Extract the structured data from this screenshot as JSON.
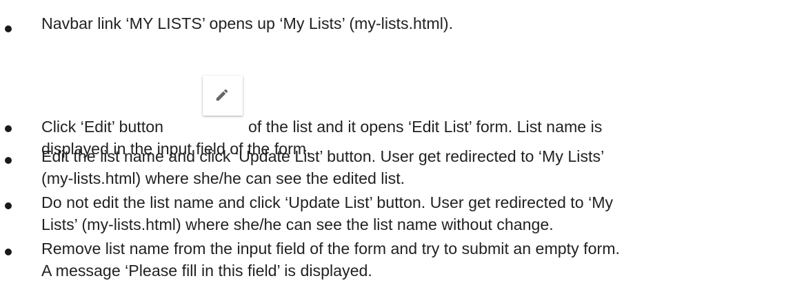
{
  "items": [
    {
      "lines": [
        "Navbar link ‘MY LISTS’ opens up ‘My Lists’ (my-lists.html)."
      ]
    },
    {
      "before_icon": "Click ‘Edit’ button",
      "after_icon": "of the list and it opens ‘Edit List’ form. List name is",
      "line2": "displayed in the input field of the form.",
      "icon": "pencil-edit-icon"
    },
    {
      "lines": [
        "Edit the list name and click ‘Update List’ button. User get redirected to ‘My Lists’",
        "(my-lists.html) where she/he can see the edited list."
      ]
    },
    {
      "lines": [
        "Do not edit the list name and click ‘Update List’ button. User get redirected to ‘My",
        "Lists’ (my-lists.html) where she/he can see the list name without change."
      ]
    },
    {
      "lines": [
        "Remove list name from the input field of the form and try to submit an empty form.",
        "A message ‘Please fill in this field’ is displayed."
      ]
    }
  ],
  "colors": {
    "text": "#222222",
    "bullet": "#1a1a1a",
    "icon": "#666666"
  }
}
